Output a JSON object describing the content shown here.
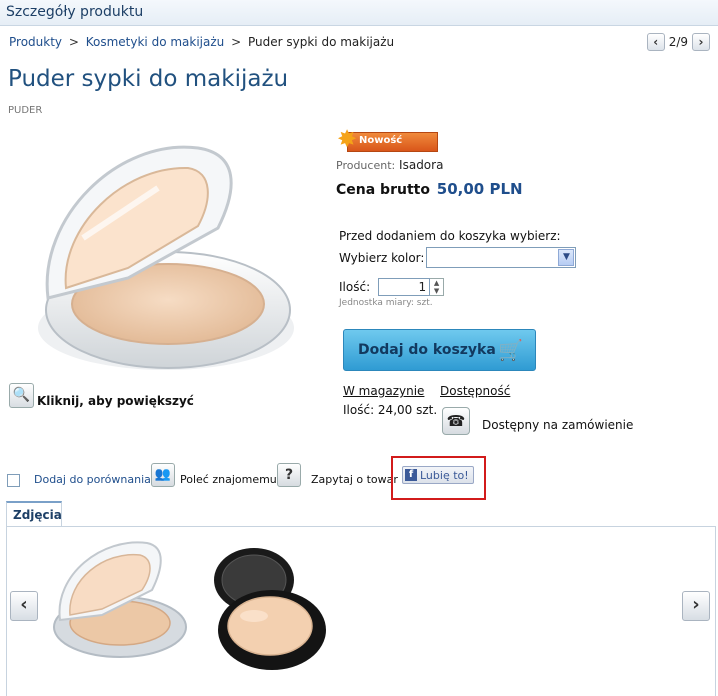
{
  "header": {
    "title": "Szczegóły produktu"
  },
  "breadcrumb": {
    "items": [
      "Produkty",
      "Kosmetyki do makijażu",
      "Puder sypki do makijażu"
    ],
    "separator": ">"
  },
  "pager": {
    "prev": "‹",
    "position": "2/9",
    "next": "›"
  },
  "product": {
    "title": "Puder sypki do makijażu",
    "category": "PUDER",
    "badge": "Nowość",
    "producer_label": "Producent:",
    "producer": "Isadora",
    "price_label": "Cena brutto",
    "price": "50,00 PLN"
  },
  "zoom": {
    "label": "Kliknij, aby powiększyć"
  },
  "options": {
    "intro": "Przed dodaniem do koszyka wybierz:",
    "color_label": "Wybierz kolor:",
    "color_value": "",
    "qty_label": "Ilość:",
    "qty_value": "1",
    "unit_text": "Jednostka miary: szt."
  },
  "cart": {
    "label": "Dodaj do koszyka"
  },
  "stock": {
    "warehouse_label": "W magazynie",
    "warehouse_qty": "Ilość: 24,00 szt.",
    "availability_label": "Dostępność",
    "availability_text": "Dostępny na zamówienie"
  },
  "actions": {
    "compare": "Dodaj do porównania",
    "recommend": "Poleć znajomemu",
    "ask": "Zapytaj o towar",
    "like": "Lubię to!"
  },
  "tabs": {
    "active": "Zdjęcia"
  },
  "gallery": {
    "prev": "‹",
    "next": "›"
  }
}
